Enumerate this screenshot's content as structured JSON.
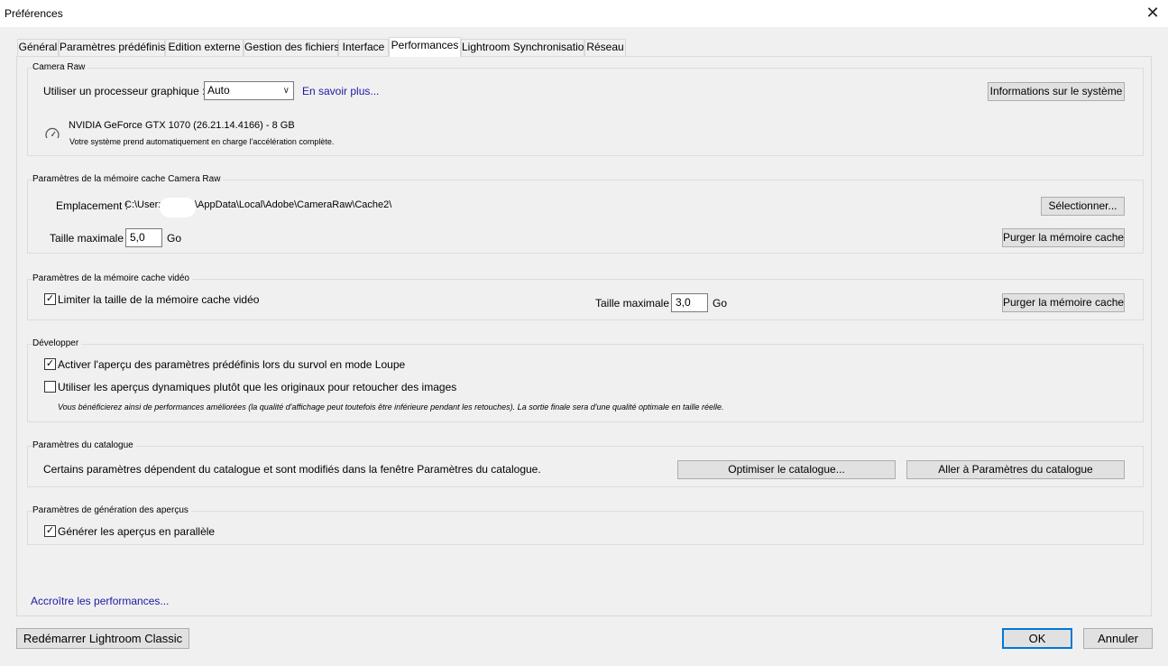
{
  "window": {
    "title": "Préférences",
    "close": "✕"
  },
  "tabs": [
    {
      "label": "Général"
    },
    {
      "label": "Paramètres prédéfinis"
    },
    {
      "label": "Edition externe"
    },
    {
      "label": "Gestion des fichiers"
    },
    {
      "label": "Interface"
    },
    {
      "label": "Performances",
      "active": true
    },
    {
      "label": "Lightroom Synchronisation"
    },
    {
      "label": "Réseau"
    }
  ],
  "camera_raw": {
    "legend": "Camera Raw",
    "gpu_label": "Utiliser un processeur graphique :",
    "gpu_select": "Auto",
    "learn_more": "En savoir plus...",
    "system_info_button": "Informations sur le système",
    "gpu_name": "NVIDIA GeForce GTX 1070 (26.21.14.4166) - 8 GB",
    "gpu_status": "Votre système prend automatiquement en charge l'accélération complète.",
    "gpu_icon": "speedometer-icon"
  },
  "camera_raw_cache": {
    "legend": "Paramètres de la mémoire cache Camera Raw",
    "location_label": "Emplacement :",
    "location_path_start": "C:\\User:",
    "location_path_end": "\\AppData\\Local\\Adobe\\CameraRaw\\Cache2\\",
    "select_button": "Sélectionner...",
    "max_size_label": "Taille maximale :",
    "max_size_value": "5,0",
    "unit": "Go",
    "purge_button": "Purger la mémoire cache"
  },
  "video_cache": {
    "legend": "Paramètres de la mémoire cache vidéo",
    "limit_label": "Limiter la taille de la mémoire cache vidéo",
    "limit_checked": true,
    "max_size_label": "Taille maximale :",
    "max_size_value": "3,0",
    "unit": "Go",
    "purge_button": "Purger la mémoire cache"
  },
  "develop": {
    "legend": "Développer",
    "preview_presets_label": "Activer l'aperçu des paramètres prédéfinis lors du survol en mode Loupe",
    "preview_presets_checked": true,
    "smart_previews_label": "Utiliser les aperçus dynamiques plutôt que les originaux pour retoucher des images",
    "smart_previews_checked": false,
    "note": "Vous bénéficierez ainsi de performances améliorées (la qualité d'affichage peut toutefois être inférieure pendant les retouches). La sortie finale sera d'une qualité optimale en taille réelle."
  },
  "catalog": {
    "legend": "Paramètres du catalogue",
    "description": "Certains paramètres dépendent du catalogue et sont modifiés dans la fenêtre Paramètres du catalogue.",
    "optimize_button": "Optimiser le catalogue...",
    "goto_button": "Aller à Paramètres du catalogue"
  },
  "preview_generation": {
    "legend": "Paramètres de génération des aperçus",
    "parallel_label": "Générer les aperçus en parallèle",
    "parallel_checked": true
  },
  "more_performance_link": "Accroître les performances...",
  "footer": {
    "restart_button": "Redémarrer Lightroom Classic",
    "ok_button": "OK",
    "cancel_button": "Annuler"
  },
  "checkmark": "✓"
}
